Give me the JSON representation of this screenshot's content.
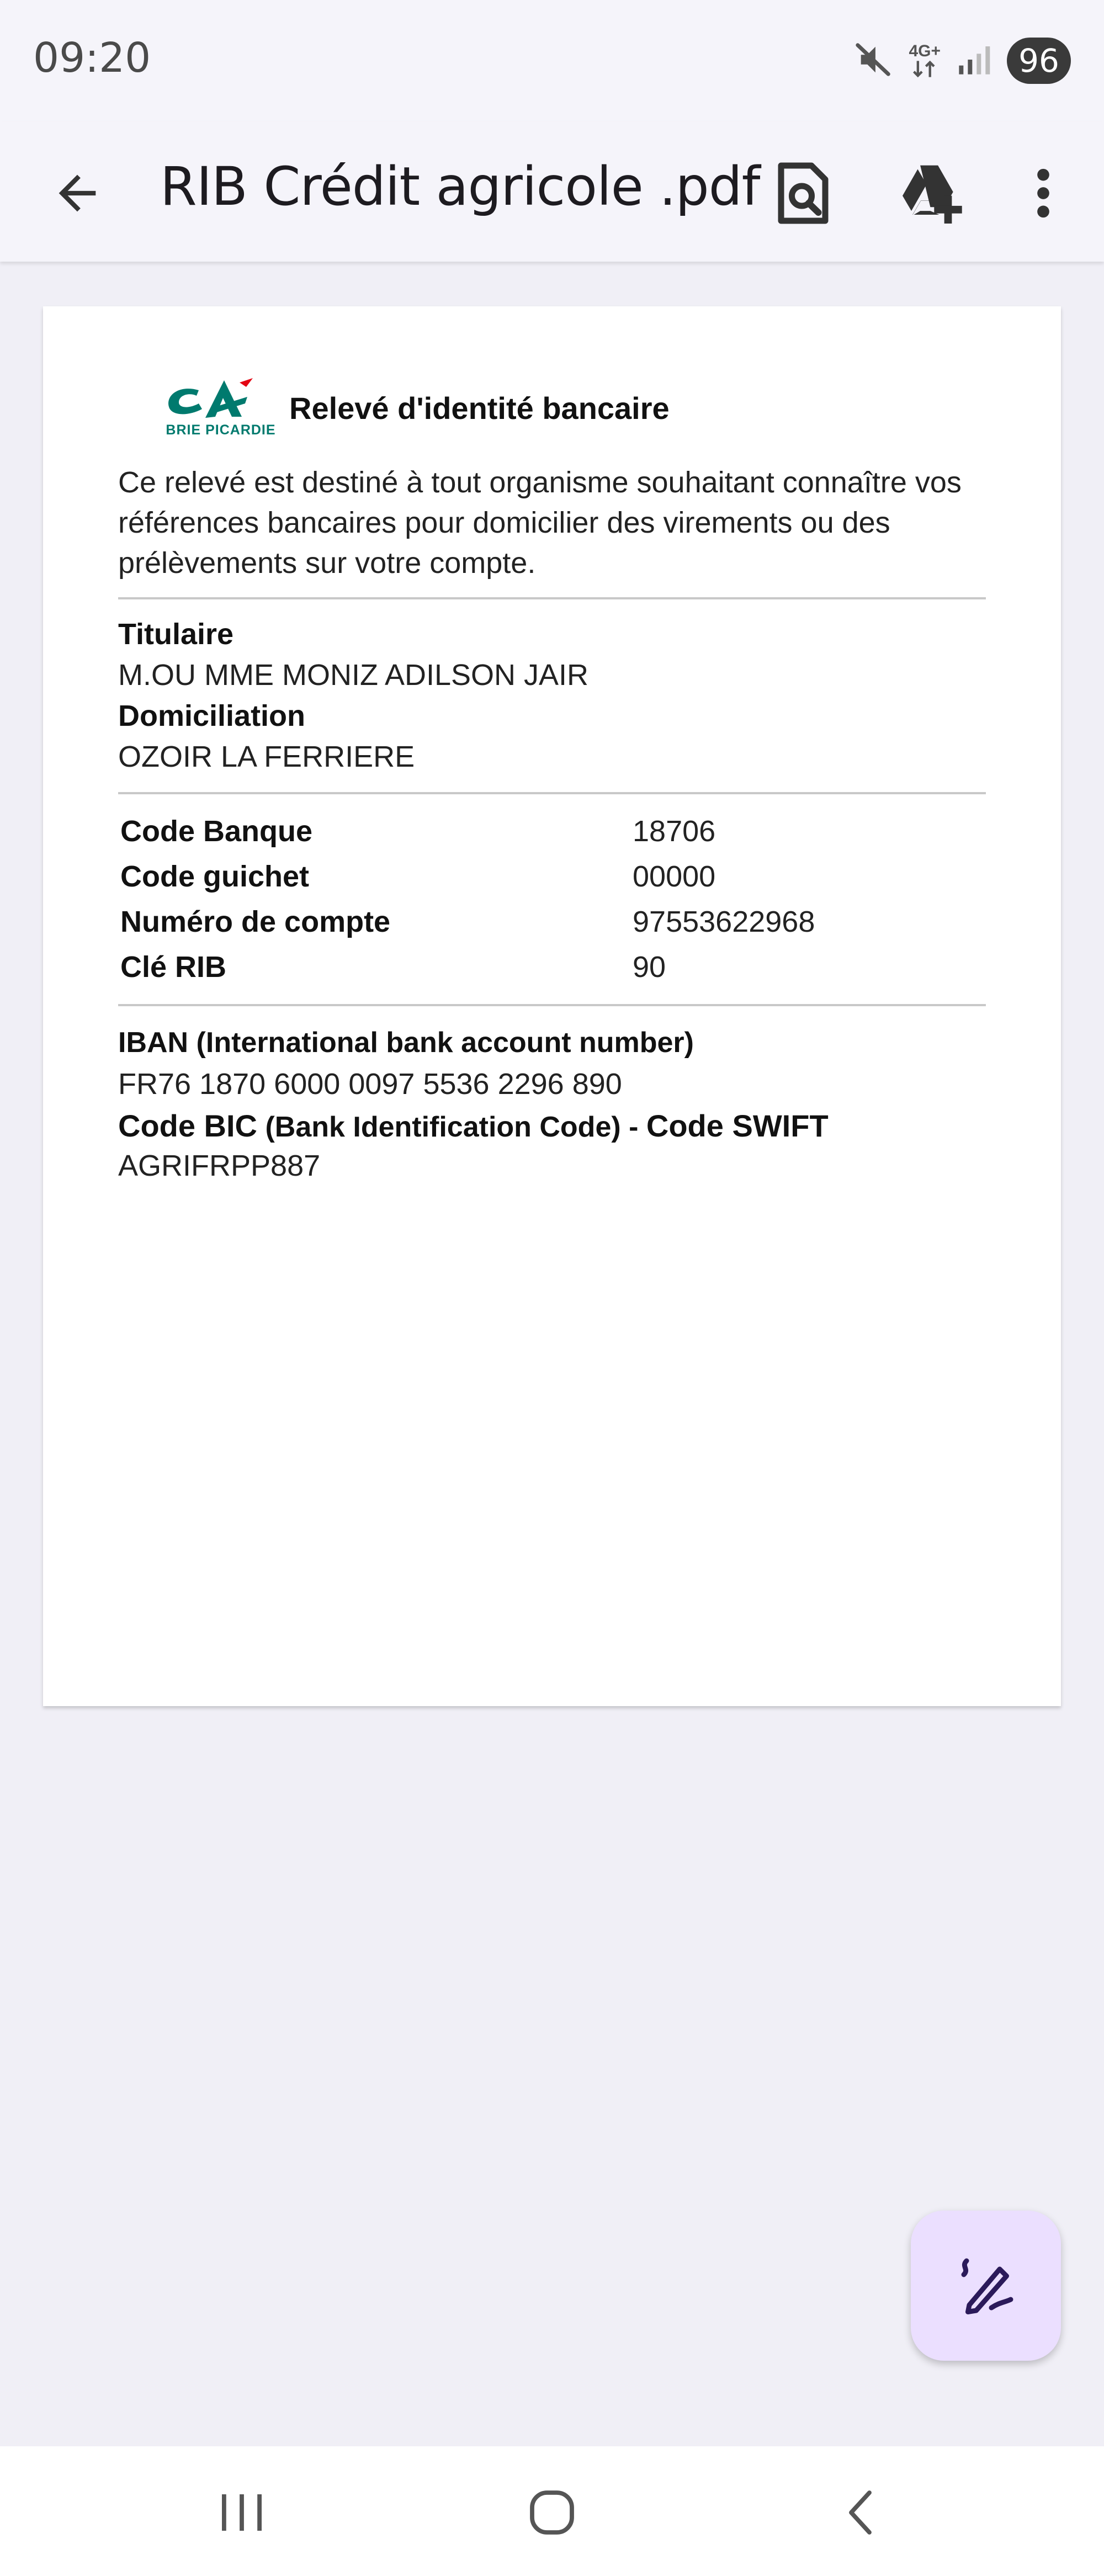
{
  "status_bar": {
    "time": "09:20",
    "network_label": "4G+",
    "battery": "96",
    "icons": [
      "mute-icon",
      "network-4g-icon",
      "signal-icon",
      "battery-icon"
    ]
  },
  "app_bar": {
    "title": "RIB Crédit agricole .pdf",
    "icons": [
      "back-arrow-icon",
      "document-search-icon",
      "drive-add-icon",
      "more-vert-icon"
    ]
  },
  "document": {
    "logo": {
      "mark": "CA",
      "caption": "BRIE PICARDIE",
      "color": "#007a6e",
      "accent": "#e30613"
    },
    "title": "Relevé d'identité bancaire",
    "intro": "Ce relevé est destiné à tout organisme souhaitant connaître vos références bancaires pour domicilier des virements ou des prélèvements sur votre compte.",
    "holder_label": "Titulaire",
    "holder_value": "M.OU MME MONIZ ADILSON JAIR",
    "domiciliation_label": "Domiciliation",
    "domiciliation_value": "OZOIR LA FERRIERE",
    "rows": [
      {
        "label": "Code Banque",
        "value": "18706"
      },
      {
        "label": "Code guichet",
        "value": "00000"
      },
      {
        "label": "Numéro de compte",
        "value": "97553622968"
      },
      {
        "label": "Clé RIB",
        "value": "90"
      }
    ],
    "iban_label_bold": "IBAN",
    "iban_label_rest": " (International bank account number)",
    "iban_value": "FR76 1870 6000 0097 5536 2296 890",
    "bic_label_bold1": "Code BIC",
    "bic_label_mid": " (Bank Identification Code) - ",
    "bic_label_bold2": "Code SWIFT",
    "bic_value": "AGRIFRPP887"
  },
  "fab": {
    "icon": "edit-pen-icon",
    "color": "#ebdfff"
  },
  "nav_bar": {
    "icons": [
      "recent-apps-icon",
      "home-icon",
      "nav-back-icon"
    ]
  }
}
